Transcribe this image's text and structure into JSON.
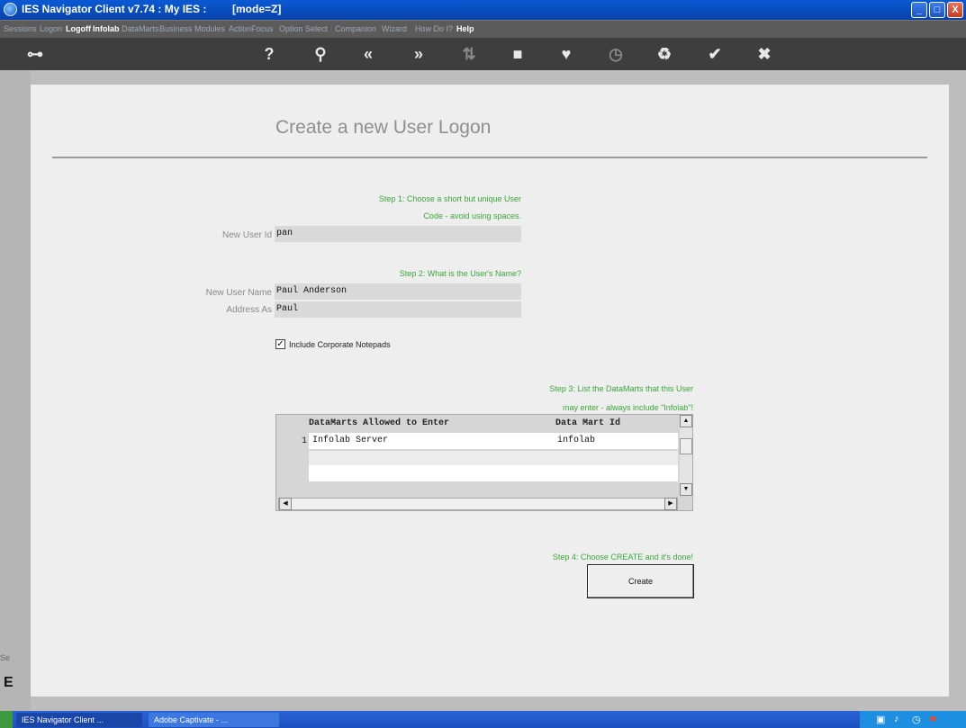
{
  "window": {
    "title": "IES Navigator Client v7.74 : My IES :",
    "mode": "[mode=Z]",
    "buttons": {
      "minimize": "_",
      "maximize": "□",
      "close": "X"
    }
  },
  "menu": [
    "Sessions",
    "Logon",
    "Logoff",
    "Infolab",
    "DataMarts",
    "Business Modules",
    "ActionFocus",
    "Option Select",
    "Companion",
    "Wizard",
    "How Do I?",
    "Help"
  ],
  "toolbar": {
    "icons": [
      "key-icon",
      "help-icon",
      "search-icon",
      "back-icon",
      "forward-icon",
      "sort-icon",
      "stop-icon",
      "heart-icon",
      "clock-icon",
      "recycle-icon",
      "check-icon",
      "close-icon"
    ],
    "glyphs": [
      "⊶",
      "?",
      "⚲",
      "«",
      "»",
      "⇅",
      "■",
      "♥",
      "◷",
      "♻",
      "✔",
      "✖"
    ]
  },
  "form": {
    "title": "Create a new User Logon",
    "step1_line1": "Step 1: Choose a short but unique User",
    "step1_line2": "Code - avoid using spaces.",
    "user_id_label": "New User Id",
    "user_id_value": "pan",
    "step2": "Step 2: What is the User's Name?",
    "user_name_label": "New User Name",
    "user_name_value": "Paul Anderson",
    "address_label": "Address As",
    "address_value": "Paul",
    "checkbox_label": "Include Corporate Notepads",
    "checkbox_checked": true,
    "step3_line1": "Step 3: List the DataMarts that this User",
    "step3_line2": "may enter - always include \"Infolab\"!",
    "step4": "Step 4: Choose CREATE and it's done!",
    "create_label": "Create"
  },
  "grid": {
    "headers": [
      "DataMarts Allowed to Enter",
      "Data Mart Id"
    ],
    "rows": [
      {
        "num": "1",
        "name": "Infolab Server",
        "id": "infolab"
      }
    ]
  },
  "left_strip": {
    "label": "Se",
    "letter": "E"
  },
  "taskbar": {
    "tasks": [
      "IES Navigator Client ...",
      "Adobe Captivate - ..."
    ]
  }
}
